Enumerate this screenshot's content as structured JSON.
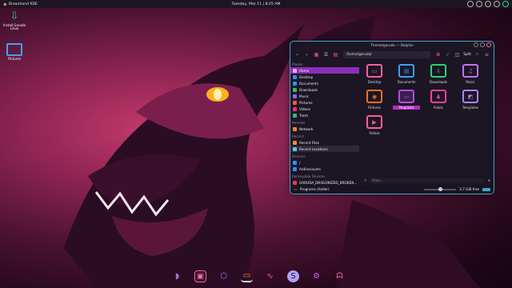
{
  "panel": {
    "menu_label": "Dreamland KDE",
    "clock": "Tuesday, Mar 11 | 8:25 AM"
  },
  "desktop": {
    "icons": [
      {
        "label_line1": "Install Garuda",
        "label_line2": "Linux",
        "icon": "download-arrow-icon"
      },
      {
        "label": "Pictures",
        "icon": "folder-icon"
      }
    ]
  },
  "window": {
    "title": "Theme/garuda — Dolphin",
    "location": "/home/garuda/",
    "split_label": "Split"
  },
  "sidebar": {
    "places_header": "Places",
    "places": [
      {
        "label": "Home",
        "color": "#c070ff"
      },
      {
        "label": "Desktop",
        "color": "#4080ff"
      },
      {
        "label": "Documents",
        "color": "#3090ff"
      },
      {
        "label": "Downloads",
        "color": "#30c060"
      },
      {
        "label": "Music",
        "color": "#9060ff"
      },
      {
        "label": "Pictures",
        "color": "#ff6020"
      },
      {
        "label": "Videos",
        "color": "#ff3060"
      },
      {
        "label": "Trash",
        "color": "#30c060"
      }
    ],
    "remote_header": "Remote",
    "remote": [
      {
        "label": "Network",
        "color": "#ff8030"
      }
    ],
    "recent_header": "Recent",
    "recent": [
      {
        "label": "Recent Files",
        "color": "#ff9020"
      },
      {
        "label": "Recent Locations",
        "color": "#60c0ff"
      }
    ],
    "devices_header": "Devices",
    "devices": [
      {
        "label": "/",
        "color": "#3090ff"
      },
      {
        "label": "Ardiescounts",
        "color": "#3090ff"
      }
    ],
    "removable_header": "Removable Devices",
    "removable": [
      {
        "label": "GARUDA_DR4GONIZED_BROKEN...",
        "color": "#ff3060"
      }
    ]
  },
  "files": [
    {
      "label": "Desktop",
      "color": "#ff5fa0",
      "glyph": "▭"
    },
    {
      "label": "Documents",
      "color": "#3da0ff",
      "glyph": "▤"
    },
    {
      "label": "Downloads",
      "color": "#30d070",
      "glyph": "⇩"
    },
    {
      "label": "Music",
      "color": "#c070ff",
      "glyph": "♫"
    },
    {
      "label": "Pictures",
      "color": "#ff7020",
      "glyph": "◉"
    },
    {
      "label": "Programs",
      "color": "#b050e0",
      "glyph": "▭"
    },
    {
      "label": "Public",
      "color": "#ff40a0",
      "glyph": "♟"
    },
    {
      "label": "Templates",
      "color": "#b080ff",
      "glyph": "◩"
    },
    {
      "label": "Videos",
      "color": "#ff6090",
      "glyph": "▶"
    }
  ],
  "filter": {
    "placeholder": "Filter..."
  },
  "status": {
    "text": "Programs (folder)",
    "free": "3.7 GiB free"
  },
  "dock": [
    {
      "name": "garuda-icon",
      "color": "#a070d0",
      "glyph": "◗"
    },
    {
      "name": "terminal-icon",
      "color": "#ff6aa0",
      "glyph": "▣"
    },
    {
      "name": "browser-icon",
      "color": "#c070ff",
      "glyph": "⬡"
    },
    {
      "name": "files-icon",
      "color": "#ff9020",
      "glyph": "▭"
    },
    {
      "name": "monitor-icon",
      "color": "#ff5fa0",
      "glyph": "∿"
    },
    {
      "name": "settings-s-icon",
      "color": "#b0a0ff",
      "glyph": "S"
    },
    {
      "name": "gear-icon",
      "color": "#d060ff",
      "glyph": "⚙"
    },
    {
      "name": "ghost-icon",
      "color": "#ff6aa0",
      "glyph": "ᗣ"
    }
  ]
}
